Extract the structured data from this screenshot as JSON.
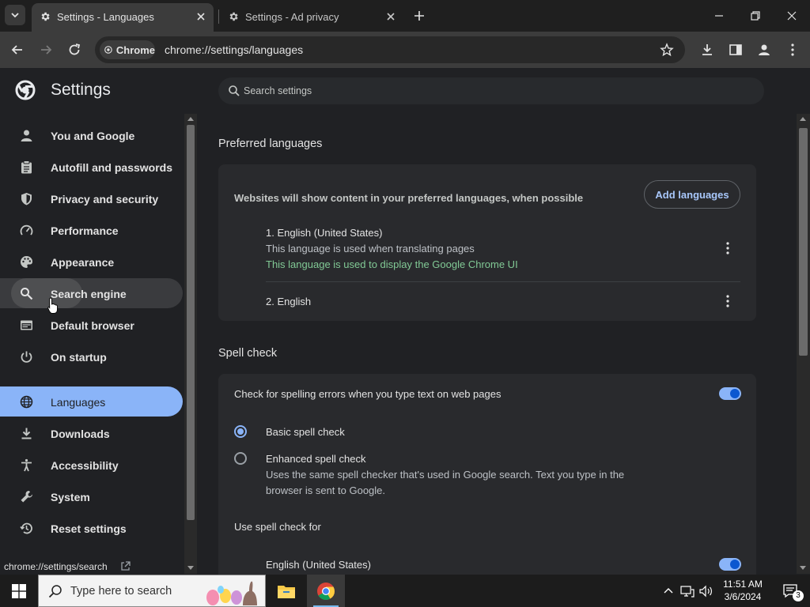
{
  "tabs": [
    {
      "title": "Settings - Languages",
      "active": true
    },
    {
      "title": "Settings - Ad privacy",
      "active": false
    }
  ],
  "toolbar": {
    "chip_label": "Chrome",
    "url": "chrome://settings/languages"
  },
  "settings": {
    "title": "Settings",
    "search_placeholder": "Search settings"
  },
  "sidebar": {
    "items": [
      {
        "label": "You and Google",
        "icon": "person-icon"
      },
      {
        "label": "Autofill and passwords",
        "icon": "clipboard-icon"
      },
      {
        "label": "Privacy and security",
        "icon": "shield-icon"
      },
      {
        "label": "Performance",
        "icon": "speedometer-icon"
      },
      {
        "label": "Appearance",
        "icon": "palette-icon"
      },
      {
        "label": "Search engine",
        "icon": "search-icon"
      },
      {
        "label": "Default browser",
        "icon": "browser-icon"
      },
      {
        "label": "On startup",
        "icon": "power-icon"
      },
      {
        "label": "Languages",
        "icon": "globe-icon"
      },
      {
        "label": "Downloads",
        "icon": "download-icon"
      },
      {
        "label": "Accessibility",
        "icon": "accessibility-icon"
      },
      {
        "label": "System",
        "icon": "wrench-icon"
      },
      {
        "label": "Reset settings",
        "icon": "history-icon"
      }
    ],
    "selected": "Languages",
    "hovered": "Search engine"
  },
  "status_url": "chrome://settings/search",
  "preferred_languages": {
    "heading": "Preferred languages",
    "description": "Websites will show content in your preferred languages, when possible",
    "add_button": "Add languages",
    "languages": [
      {
        "name": "1. English (United States)",
        "note1": "This language is used when translating pages",
        "note2": "This language is used to display the Google Chrome UI"
      },
      {
        "name": "2. English"
      }
    ]
  },
  "spell_check": {
    "heading": "Spell check",
    "toggle_label": "Check for spelling errors when you type text on web pages",
    "toggle_on": true,
    "basic_label": "Basic spell check",
    "enhanced_label": "Enhanced spell check",
    "enhanced_desc_line1": "Uses the same spell checker that's used in Google search. Text you type in the",
    "enhanced_desc_line2": "browser is sent to Google.",
    "selected_option": "basic",
    "use_for_label": "Use spell check for",
    "use_for_language": "English (United States)",
    "use_for_on": true
  },
  "taskbar": {
    "search_placeholder": "Type here to search",
    "time": "11:51 AM",
    "date": "3/6/2024",
    "notification_count": "3"
  },
  "colors": {
    "accent": "#8ab4f8",
    "green_note": "#81c995",
    "page_bg": "#202124",
    "card_bg": "#292a2d"
  }
}
